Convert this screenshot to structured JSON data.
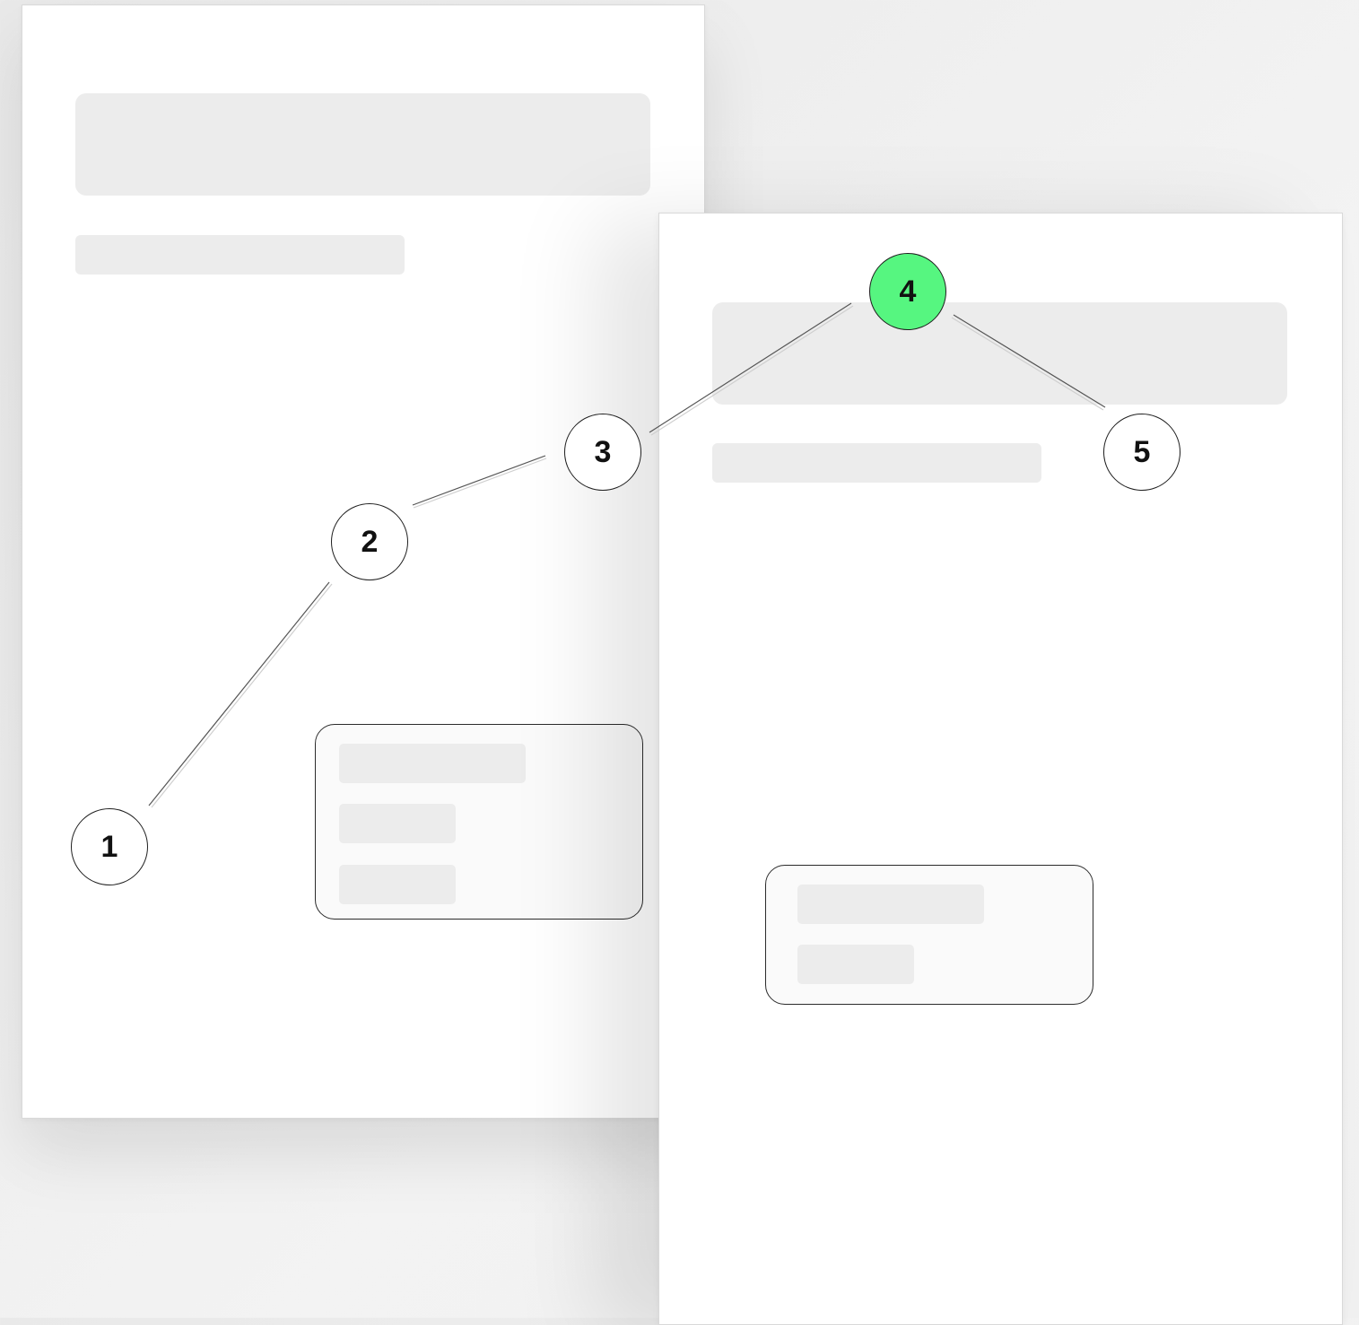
{
  "nodes": [
    {
      "label": "1",
      "state": "default"
    },
    {
      "label": "2",
      "state": "default"
    },
    {
      "label": "3",
      "state": "default"
    },
    {
      "label": "4",
      "state": "active"
    },
    {
      "label": "5",
      "state": "default"
    }
  ],
  "edges": [
    [
      "1",
      "2"
    ],
    [
      "2",
      "3"
    ],
    [
      "3",
      "4"
    ],
    [
      "4",
      "5"
    ]
  ],
  "colors": {
    "active_node": "#56f680",
    "node_fill": "#ffffff",
    "node_stroke": "#1e1e1e",
    "placeholder": "#ececec",
    "card_background": "#ffffff",
    "page_background": "#f0f0f0"
  }
}
